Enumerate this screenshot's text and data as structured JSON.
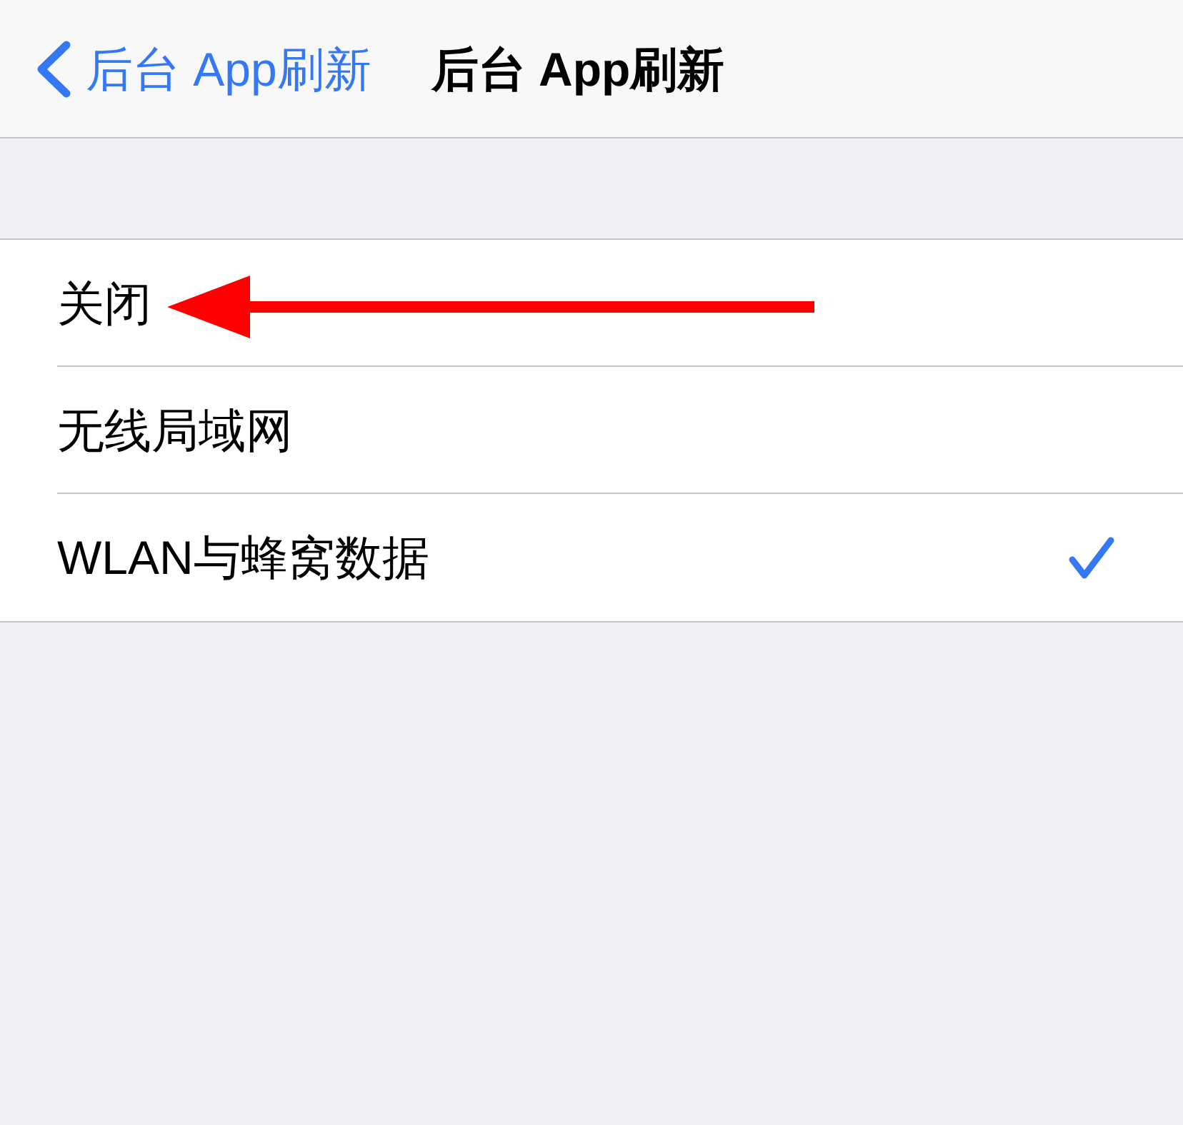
{
  "nav_bar": {
    "back_button": {
      "label": "后台 App刷新"
    },
    "title": "后台 App刷新"
  },
  "options": [
    {
      "label": "关闭",
      "selected": false,
      "marked_by_arrow": true
    },
    {
      "label": "无线局域网",
      "selected": false,
      "marked_by_arrow": false
    },
    {
      "label": "WLAN与蜂窝数据",
      "selected": true,
      "marked_by_arrow": false
    }
  ]
}
